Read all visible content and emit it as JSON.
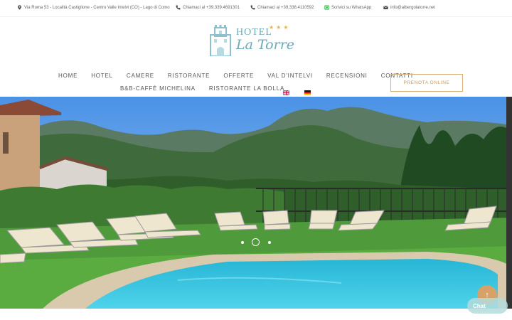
{
  "topbar": {
    "address": "Via Roma 53 - Località Castiglione - Centro Valle Intelvi (CO) - Lago di Como",
    "phone1": "Chiamaci al +39.339.4691301",
    "phone2": "Chiamaci al +39.338.4110592",
    "whatsapp": "Scrivici su WhatsApp",
    "email": "info@albergolatorre.net",
    "icons": [
      "map-pin-icon",
      "phone-icon",
      "phone-icon",
      "whatsapp-icon",
      "mail-icon"
    ]
  },
  "logo": {
    "hotel": "HOTEL",
    "name": "La Torre",
    "stars": "★★★"
  },
  "nav": {
    "row1": [
      "HOME",
      "HOTEL",
      "CAMERE",
      "RISTORANTE",
      "OFFERTE",
      "VAL D'INTELVI",
      "RECENSIONI",
      "CONTATTI"
    ],
    "row2": [
      "B&B-CAFFÈ MICHELINA",
      "RISTORANTE LA BOLLA"
    ],
    "languages": [
      "english-flag-icon",
      "german-flag-icon"
    ]
  },
  "booking": {
    "label": "PRENOTA ONLINE"
  },
  "slider": {
    "slide_count": 3,
    "active_slide": 2
  },
  "chat": {
    "label": "Chat"
  },
  "colors": {
    "accent_teal": "#6fa9b8",
    "accent_gold": "#d8b27a",
    "star_gold": "#e8b547",
    "pool_blue": "#3cc4de"
  }
}
